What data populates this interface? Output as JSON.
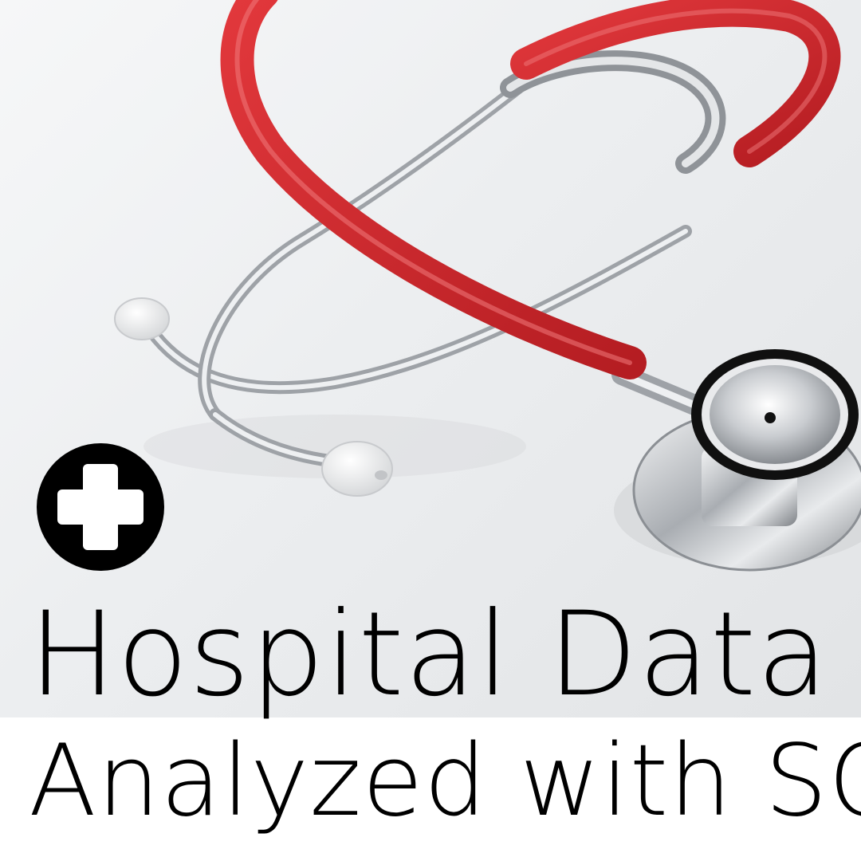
{
  "title_line_1": "Hospital Data",
  "title_line_2": "Analyzed with SQL",
  "colors": {
    "tube": "#d2262b",
    "metal": "#b8bcc0",
    "text": "#000000",
    "badge": "#000000",
    "band": "#ffffff"
  },
  "icons": {
    "badge": "medical-cross-icon"
  }
}
